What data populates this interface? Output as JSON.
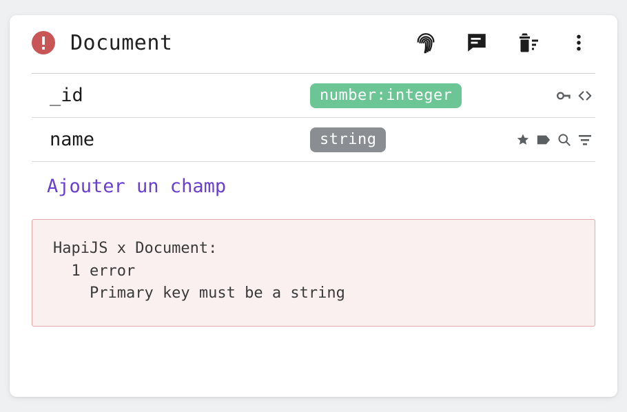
{
  "header": {
    "title": "Document"
  },
  "fields": [
    {
      "name": "_id",
      "type": "number:integer",
      "type_color": "green",
      "icons": [
        "key",
        "code"
      ]
    },
    {
      "name": "name",
      "type": "string",
      "type_color": "gray",
      "icons": [
        "star",
        "label",
        "search",
        "filter"
      ]
    }
  ],
  "add_field_label": "Ajouter un champ",
  "error": {
    "text": "HapiJS x Document:\n  1 error\n    Primary key must be a string"
  }
}
